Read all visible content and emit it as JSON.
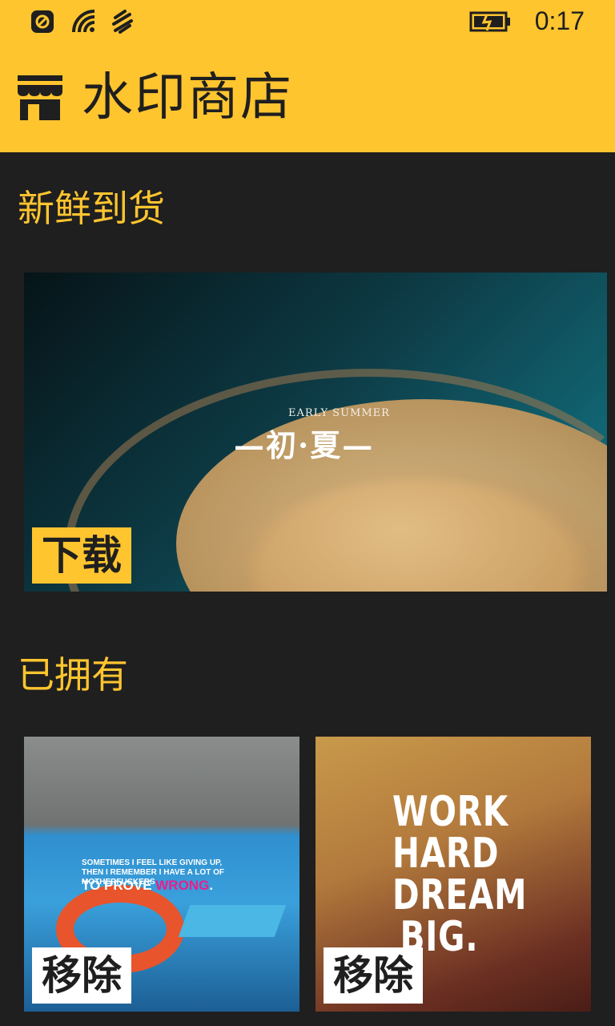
{
  "status": {
    "time": "0:17"
  },
  "header": {
    "title": "水印商店"
  },
  "sections": {
    "new_arrivals": "新鲜到货",
    "owned": "已拥有"
  },
  "featured": {
    "overlay_small": "EARLY SUMMER",
    "overlay_big": "—初·夏—",
    "action": "下载"
  },
  "owned_items": [
    {
      "quote_line1": "SOMETIMES I FEEL LIKE GIVING UP,",
      "quote_line2": "THEN I REMEMBER I HAVE A LOT OF MOTHERFUCKERS",
      "quote_line3a": "TO PROVE ",
      "quote_line3b": "WRONG",
      "quote_line3c": ".",
      "action": "移除"
    },
    {
      "quote_line1": "WORK",
      "quote_line2": "HARD",
      "quote_line3": "DREAM",
      "quote_line4": "BIG.",
      "action": "移除"
    }
  ],
  "colors": {
    "accent": "#ffc52f",
    "background": "#1f1f1f"
  },
  "icons": [
    "nfc-icon",
    "wifi-icon",
    "signal-icon",
    "battery-charging-icon",
    "store-icon"
  ]
}
